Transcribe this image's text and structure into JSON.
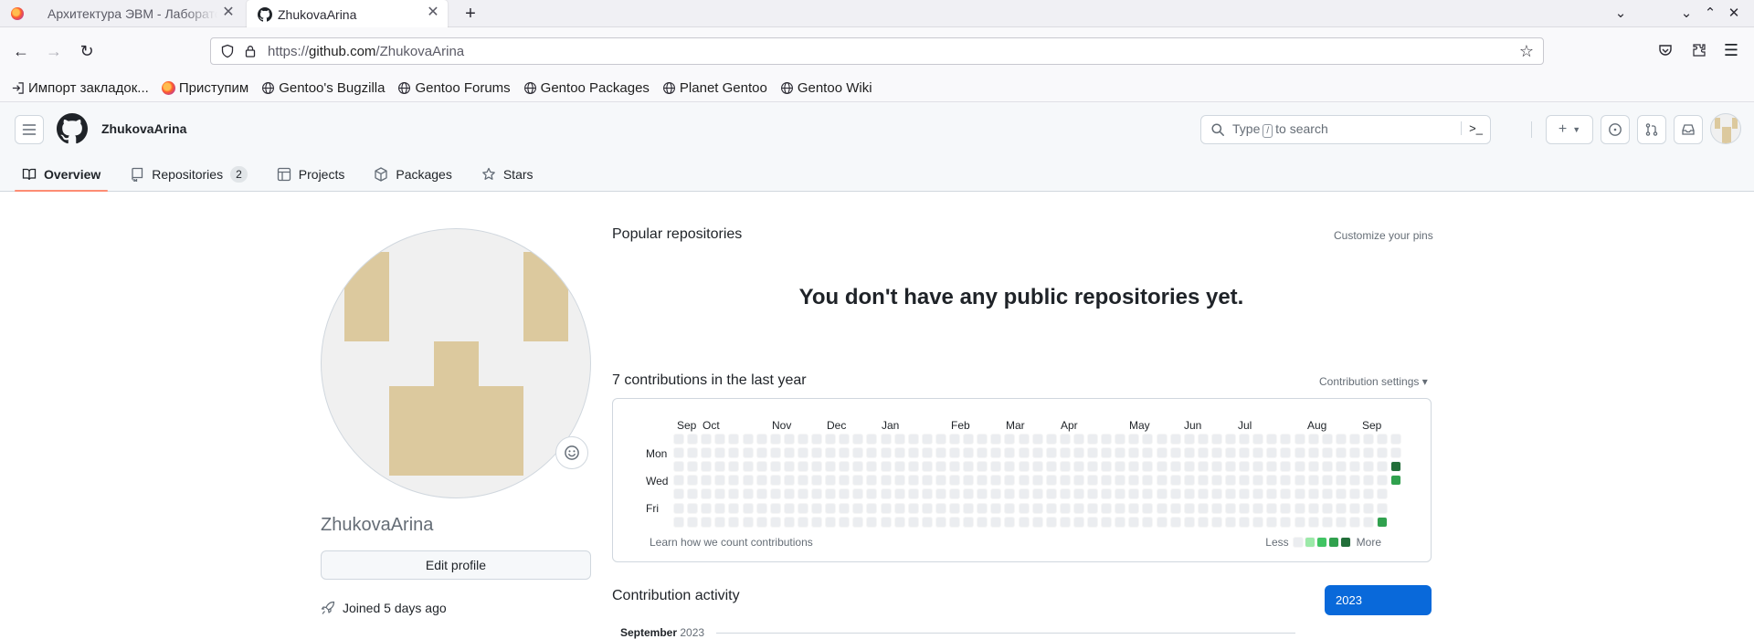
{
  "browser": {
    "tabs": [
      {
        "title": "Архитектура ЭВМ - Лабораторная"
      },
      {
        "title": "ZhukovaArina"
      }
    ],
    "url": {
      "prefix": "https://",
      "domain": "github.com",
      "path": "/ZhukovaArina"
    },
    "bookmarks": [
      {
        "label": "Импорт закладок...",
        "icon": "import-icon"
      },
      {
        "label": "Приступим",
        "icon": "firefox-icon"
      },
      {
        "label": "Gentoo's Bugzilla",
        "icon": "globe-icon"
      },
      {
        "label": "Gentoo Forums",
        "icon": "globe-icon"
      },
      {
        "label": "Gentoo Packages",
        "icon": "globe-icon"
      },
      {
        "label": "Planet Gentoo",
        "icon": "globe-icon"
      },
      {
        "label": "Gentoo Wiki",
        "icon": "globe-icon"
      }
    ]
  },
  "header": {
    "context_user": "ZhukovaArina",
    "search": {
      "before": "Type",
      "key": "/",
      "after": "to search",
      "cmd": ">_"
    },
    "profile_tabs": [
      {
        "label": "Overview",
        "icon": "book-icon",
        "active": true
      },
      {
        "label": "Repositories",
        "icon": "repo-icon",
        "count": "2"
      },
      {
        "label": "Projects",
        "icon": "table-icon"
      },
      {
        "label": "Packages",
        "icon": "package-icon"
      },
      {
        "label": "Stars",
        "icon": "star-icon"
      }
    ]
  },
  "sidebar": {
    "username": "ZhukovaArina",
    "edit_label": "Edit profile",
    "joined": "Joined 5 days ago"
  },
  "main": {
    "popular_title": "Popular repositories",
    "customize_pins": "Customize your pins",
    "empty_message": "You don't have any public repositories yet.",
    "contrib_title": "7 contributions in the last year",
    "contrib_settings": "Contribution settings ▾",
    "months": [
      "Sep",
      "Oct",
      "Nov",
      "Dec",
      "Jan",
      "Feb",
      "Mar",
      "Apr",
      "May",
      "Jun",
      "Jul",
      "Aug",
      "Sep"
    ],
    "days": [
      "Mon",
      "Wed",
      "Fri"
    ],
    "learn_link": "Learn how we count contributions",
    "legend_less": "Less",
    "legend_more": "More",
    "activity_title": "Contribution activity",
    "year": "2023",
    "activity_month": "September",
    "activity_year": "2023"
  },
  "colors": {
    "level0": "#ebedf0",
    "level1": "#9be9a8",
    "level2": "#40c463",
    "level3": "#30a14e",
    "level4": "#216e39",
    "accent": "#0969da",
    "tab_underline": "#fd8c73"
  },
  "contributions": {
    "weeks": 53,
    "active": [
      {
        "week": 52,
        "day": 2,
        "level": 4
      },
      {
        "week": 52,
        "day": 3,
        "level": 3
      },
      {
        "week": 51,
        "day": 6,
        "level": 3
      }
    ]
  }
}
